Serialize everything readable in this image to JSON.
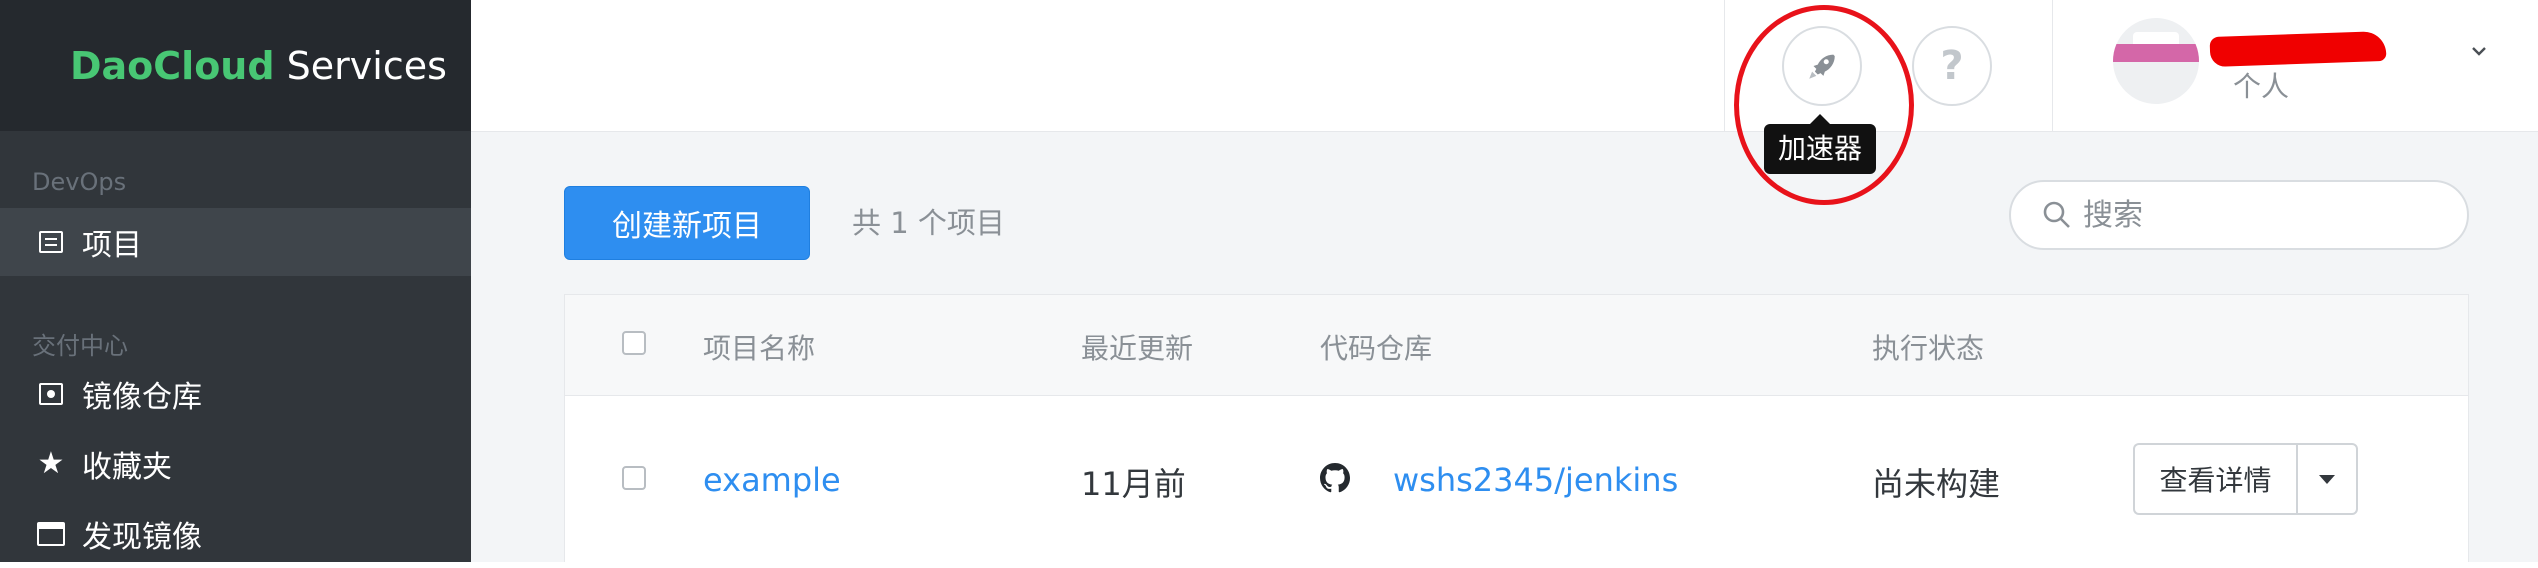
{
  "sidebar": {
    "logo": {
      "brand": "DaoCloud",
      "rest": " Services"
    },
    "sections": [
      {
        "title": "DevOps",
        "items": [
          {
            "label": "项目",
            "icon": "list-icon",
            "active": true
          }
        ]
      },
      {
        "title": "交付中心",
        "items": [
          {
            "label": "镜像仓库",
            "icon": "image-icon"
          },
          {
            "label": "收藏夹",
            "icon": "star-icon"
          },
          {
            "label": "发现镜像",
            "icon": "store-icon"
          }
        ]
      }
    ]
  },
  "header": {
    "rocket_icon": "rocket-icon",
    "help_label": "?",
    "tooltip": "加速器",
    "user_role": "个人",
    "chevron_icon": "chevron-down-icon"
  },
  "main": {
    "create_button": "创建新项目",
    "count_text": "共 1 个项目",
    "search_placeholder": "搜索",
    "table": {
      "headers": [
        "项目名称",
        "最近更新",
        "代码仓库",
        "执行状态"
      ],
      "rows": [
        {
          "name": "example",
          "updated": "11月前",
          "repo": "wshs2345/jenkins",
          "status": "尚未构建",
          "action": "查看详情"
        }
      ]
    }
  },
  "colors": {
    "sidebar": "#31363b",
    "logo_bar": "#25292e",
    "brand_green": "#48c774",
    "primary": "#2e8ef0",
    "annotation_red": "#e8121a"
  }
}
